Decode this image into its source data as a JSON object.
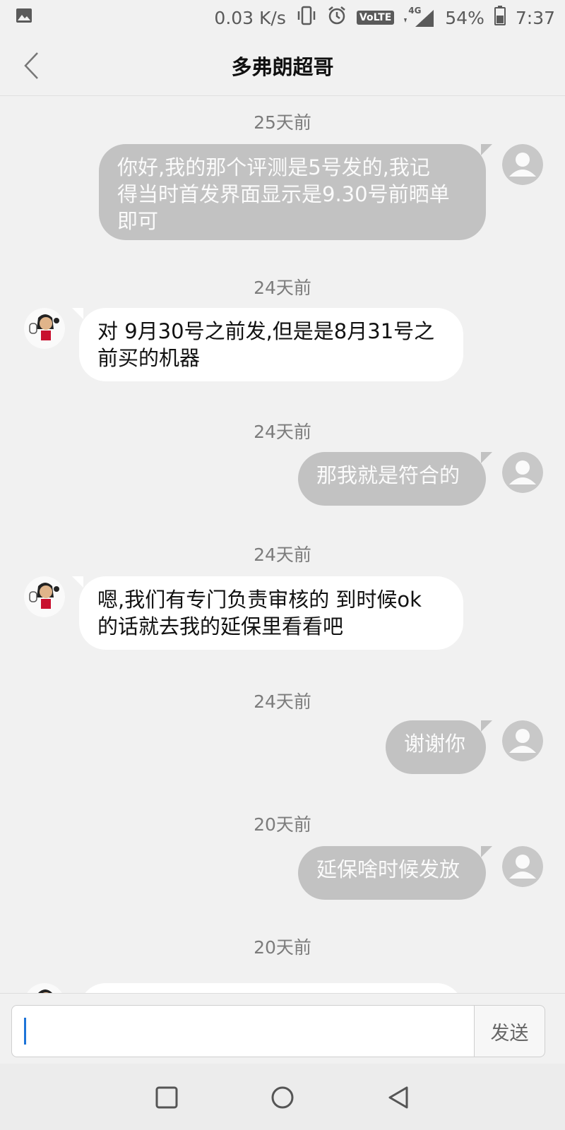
{
  "status_bar": {
    "speed": "0.03 K/s",
    "volte": "VoLTE",
    "network": "4G",
    "battery": "54%",
    "time": "7:37",
    "icons": [
      "gallery-icon",
      "vibrate-icon",
      "alarm-icon",
      "signal-icon",
      "battery-icon"
    ]
  },
  "header": {
    "title": "多弗朗超哥",
    "back_icon": "chevron-left-icon"
  },
  "messages": [
    {
      "time": "25天前",
      "from": "me",
      "lines": [
        "你好,我的那个评测是5号发的,我记",
        "得当时首发界面显示是9.30号前晒单",
        "即可"
      ]
    },
    {
      "time": "24天前",
      "from": "other",
      "lines": [
        "对 9月30号之前发,但是是8月31号之",
        "前买的机器"
      ]
    },
    {
      "time": "24天前",
      "from": "me",
      "lines": [
        "那我就是符合的"
      ]
    },
    {
      "time": "24天前",
      "from": "other",
      "lines": [
        "嗯,我们有专门负责审核的 到时候ok",
        "的话就去我的延保里看看吧"
      ]
    },
    {
      "time": "24天前",
      "from": "me",
      "lines": [
        "谢谢你"
      ]
    },
    {
      "time": "20天前",
      "from": "me",
      "lines": [
        "延保啥时候发放"
      ]
    },
    {
      "time": "20天前",
      "from": "other",
      "lines": [
        ""
      ]
    }
  ],
  "input": {
    "value": "",
    "send_label": "发送"
  },
  "nav": {
    "icons": [
      "recents-square-icon",
      "home-circle-icon",
      "back-triangle-icon"
    ]
  },
  "colors": {
    "outgoing_bubble": "#c2c2c2",
    "incoming_bubble": "#ffffff",
    "background": "#f1f1f1",
    "caret": "#1e74d8"
  }
}
